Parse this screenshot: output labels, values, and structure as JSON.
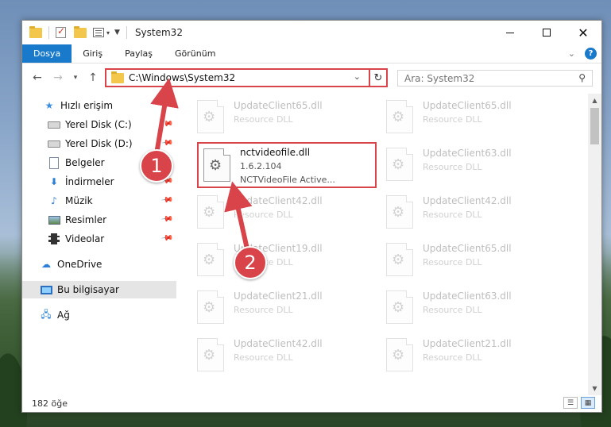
{
  "window": {
    "title": "System32"
  },
  "ribbon": {
    "tabs": [
      {
        "label": "Dosya",
        "active": true
      },
      {
        "label": "Giriş",
        "active": false
      },
      {
        "label": "Paylaş",
        "active": false
      },
      {
        "label": "Görünüm",
        "active": false
      }
    ],
    "help_label": "?"
  },
  "navigation": {
    "address": "C:\\Windows\\System32",
    "search_placeholder": "Ara: System32"
  },
  "sidebar": {
    "items": [
      {
        "label": "Hızlı erişim",
        "icon": "star-icon",
        "pinned": false
      },
      {
        "label": "Yerel Disk (C:)",
        "icon": "drive-icon",
        "pinned": true
      },
      {
        "label": "Yerel Disk (D:)",
        "icon": "drive-icon",
        "pinned": true
      },
      {
        "label": "Belgeler",
        "icon": "document-icon",
        "pinned": true
      },
      {
        "label": "İndirmeler",
        "icon": "download-icon",
        "pinned": true
      },
      {
        "label": "Müzik",
        "icon": "music-icon",
        "pinned": true
      },
      {
        "label": "Resimler",
        "icon": "pictures-icon",
        "pinned": true
      },
      {
        "label": "Videolar",
        "icon": "video-icon",
        "pinned": true
      },
      {
        "label": "OneDrive",
        "icon": "cloud-icon",
        "pinned": false
      },
      {
        "label": "Bu bilgisayar",
        "icon": "computer-icon",
        "pinned": false,
        "selected": true
      },
      {
        "label": "Ağ",
        "icon": "network-icon",
        "pinned": false
      }
    ]
  },
  "files": {
    "highlighted": {
      "name": "nctvideofile.dll",
      "version": "1.6.2.104",
      "description": "NCTVideoFile Active..."
    },
    "left_column": [
      {
        "name": "UpdateClient65.dll",
        "type": "Resource DLL"
      },
      {
        "name": "UpdateClient42.dll",
        "type": "Resource DLL"
      },
      {
        "name": "UpdateClient19.dll",
        "type": "Resource DLL"
      },
      {
        "name": "UpdateClient21.dll",
        "type": "Resource DLL"
      },
      {
        "name": "UpdateClient42.dll",
        "type": "Resource DLL"
      }
    ],
    "right_column": [
      {
        "name": "UpdateClient65.dll",
        "type": "Resource DLL"
      },
      {
        "name": "UpdateClient63.dll",
        "type": "Resource DLL"
      },
      {
        "name": "UpdateClient42.dll",
        "type": "Resource DLL"
      },
      {
        "name": "UpdateClient65.dll",
        "type": "Resource DLL"
      },
      {
        "name": "UpdateClient63.dll",
        "type": "Resource DLL"
      },
      {
        "name": "UpdateClient21.dll",
        "type": "Resource DLL"
      }
    ]
  },
  "status": {
    "item_count": "182 öğe"
  },
  "annotations": {
    "step1": "1",
    "step2": "2",
    "color": "#d9444a"
  }
}
